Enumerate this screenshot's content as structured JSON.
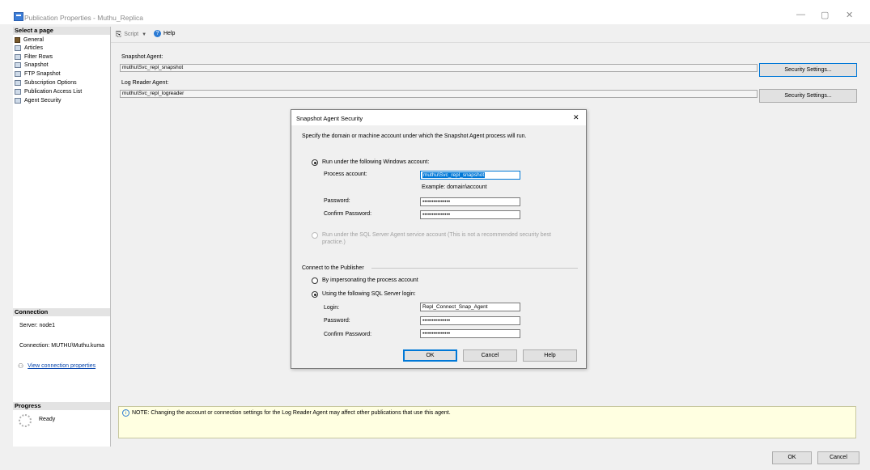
{
  "window": {
    "title": "Publication Properties - Muthu_Replica",
    "minimize": "—",
    "maximize": "▢",
    "close": "✕"
  },
  "sidebar": {
    "select_header": "Select a page",
    "items": [
      {
        "label": "General"
      },
      {
        "label": "Articles"
      },
      {
        "label": "Filter Rows"
      },
      {
        "label": "Snapshot"
      },
      {
        "label": "FTP Snapshot"
      },
      {
        "label": "Subscription Options"
      },
      {
        "label": "Publication Access List"
      },
      {
        "label": "Agent Security"
      }
    ],
    "connection_header": "Connection",
    "server": "Server: node1",
    "connection": "Connection: MUTHU\\Muthu.kuma",
    "view_link": "View connection properties",
    "progress_header": "Progress",
    "progress_status": "Ready"
  },
  "toolbar": {
    "script": "Script",
    "help": "Help"
  },
  "main": {
    "snapshot_label": "Snapshot Agent:",
    "snapshot_value": "muthu\\Svc_repl_snapshot",
    "logreader_label": "Log Reader Agent:",
    "logreader_value": "muthu\\Svc_repl_logreader",
    "security_btn": "Security Settings...",
    "note": "NOTE: Changing the account or connection settings for the Log Reader Agent may affect other publications that use this agent."
  },
  "dialog": {
    "title": "Snapshot Agent Security",
    "close": "✕",
    "desc": "Specify the domain or machine account under which the Snapshot Agent process will run.",
    "run_windows": "Run under the following Windows account:",
    "process_account_label": "Process account:",
    "process_account_value": "muthu\\Svc_repl_snapshot",
    "example": "Example: domain\\account",
    "password_label": "Password:",
    "password_value": "•••••••••••••••",
    "confirm_label": "Confirm Password:",
    "confirm_value": "•••••••••••••••",
    "run_sql_agent_1": "Run under the SQL Server Agent service account (This is not a recommended security best",
    "run_sql_agent_2": "practice.)",
    "connect_group": "Connect to the Publisher",
    "impersonate": "By impersonating the process account",
    "sql_login": "Using the following SQL Server login:",
    "login_label": "Login:",
    "login_value": "Repl_Connect_Snap_Agent",
    "password2_label": "Password:",
    "password2_value": "•••••••••••••••",
    "confirm2_label": "Confirm Password:",
    "confirm2_value": "•••••••••••••••",
    "ok": "OK",
    "cancel": "Cancel",
    "help": "Help"
  },
  "footer": {
    "ok": "OK",
    "cancel": "Cancel"
  }
}
